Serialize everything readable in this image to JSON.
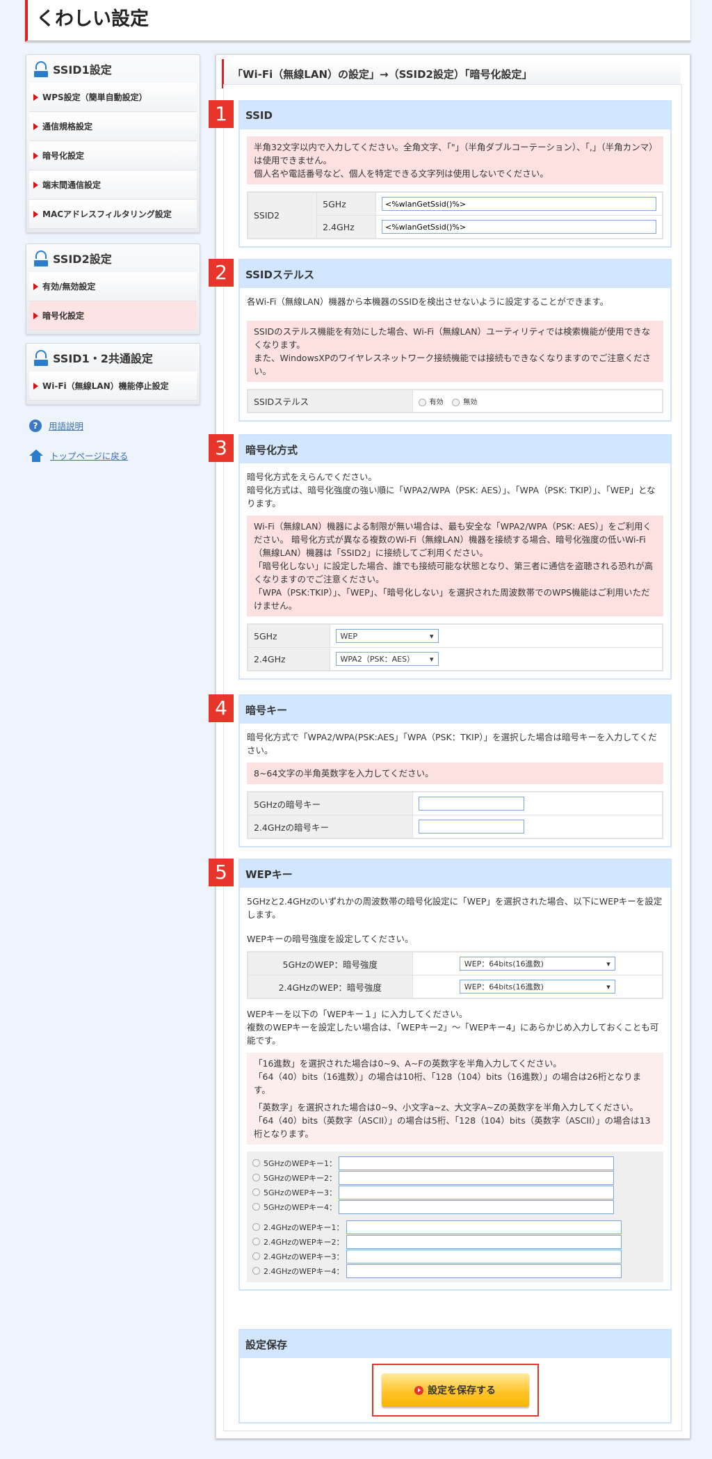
{
  "header": {
    "title": "くわしい設定"
  },
  "sidebar": {
    "groups": [
      {
        "title": "SSID1設定",
        "items": [
          "WPS設定（簡単自動設定）",
          "通信規格設定",
          "暗号化設定",
          "端末間通信設定",
          "MACアドレスフィルタリング設定"
        ]
      },
      {
        "title": "SSID2設定",
        "items": [
          "有効/無効設定",
          "暗号化設定"
        ]
      },
      {
        "title": "SSID1・2共通設定",
        "items": [
          "Wi-Fi（無線LAN）機能停止設定"
        ]
      }
    ],
    "links": {
      "glossary": "用語説明",
      "top": "トップページに戻る"
    }
  },
  "main": {
    "title": "「Wi-Fi（無線LAN）の設定」→（SSID2設定）「暗号化設定」",
    "s1": {
      "num": "1",
      "title": "SSID",
      "warn": "半角32文字以内で入力してください。全角文字、「\"」（半角ダブルコーテーション）、「,」（半角カンマ）は使用できません。",
      "warn2": "個人名や電話番号など、個人を特定できる文字列は使用しないでください。",
      "row_label": "SSID2",
      "b5": "5GHz",
      "b24": "2.4GHz",
      "v5": "<%wlanGetSsid()%>",
      "v24": "<%wlanGetSsid()%>"
    },
    "s2": {
      "num": "2",
      "title": "SSIDステルス",
      "desc": "各Wi-Fi（無線LAN）機器から本機器のSSIDを検出させないように設定することができます。",
      "warn": "SSIDのステルス機能を有効にした場合、Wi-Fi（無線LAN）ユーティリティでは検索機能が使用できなくなります。",
      "warn2": "また、WindowsXPのワイヤレスネットワーク接続機能では接続もできなくなりますのでご注意ください。",
      "label": "SSIDステルス",
      "on": "有効",
      "off": "無効"
    },
    "s3": {
      "num": "3",
      "title": "暗号化方式",
      "desc1": "暗号化方式をえらんでください。",
      "desc2": "暗号化方式は、暗号化強度の強い順に「WPA2/WPA（PSK: AES）」、「WPA（PSK: TKIP）」、「WEP」となります。",
      "warn1": "Wi-Fi（無線LAN）機器による制限が無い場合は、最も安全な「WPA2/WPA（PSK: AES）」をご利用ください。 暗号化方式が異なる複数のWi-Fi（無線LAN）機器を接続する場合、暗号化強度の低いWi-Fi（無線LAN）機器は「SSID2」に接続してご利用ください。",
      "warn2": "「暗号化しない」に設定した場合、誰でも接続可能な状態となり、第三者に通信を盗聴される恐れが高くなりますのでご注意ください。",
      "warn3": "「WPA（PSK:TKIP）」、「WEP」、「暗号化しない」を選択された周波数帯でのWPS機能はご利用いただけません。",
      "b5": "5GHz",
      "b24": "2.4GHz",
      "v5": "WEP",
      "v24": "WPA2（PSK：AES）"
    },
    "s4": {
      "num": "4",
      "title": "暗号キー",
      "desc": "暗号化方式で「WPA2/WPA(PSK:AES」「WPA（PSK：TKIP）」を選択した場合は暗号キーを入力してください。",
      "warn": "8~64文字の半角英数字を入力してください。",
      "l5": "5GHzの暗号キー",
      "l24": "2.4GHzの暗号キー"
    },
    "s5": {
      "num": "5",
      "title": "WEPキー",
      "desc": "5GHzと2.4GHzのいずれかの周波数帯の暗号化設定に「WEP」を選択された場合、以下にWEPキーを設定します。",
      "desc2": "WEPキーの暗号強度を設定してください。",
      "l5": "5GHzのWEP：暗号強度",
      "l24": "2.4GHzのWEP：暗号強度",
      "v5": "WEP：64bits(16進数)",
      "v24": "WEP：64bits(16進数)",
      "desc3": "WEPキーを以下の「WEPキー１」に入力してください。",
      "desc4": "複数のWEPキーを設定したい場合は、「WEPキー2」～「WEPキー4」にあらかじめ入力しておくことも可能です。",
      "w1": "「16進数」を選択された場合は0~9、A~Fの英数字を半角入力してください。",
      "w2": "「64（40）bits（16進数）」の場合は10桁、「128（104）bits（16進数）」の場合は26桁となります。",
      "w3": "「英数字」を選択された場合は0~9、小文字a~z、大文字A~Zの英数字を半角入力してください。",
      "w4": "「64（40）bits（英数字（ASCII）」の場合は5桁、「128（104）bits（英数字（ASCII）」の場合は13桁となります。",
      "keys5": [
        "5GHzのWEPキー1：",
        "5GHzのWEPキー2：",
        "5GHzのWEPキー3：",
        "5GHzのWEPキー4："
      ],
      "keys24": [
        "2.4GHzのWEPキー1：",
        "2.4GHzのWEPキー2：",
        "2.4GHzのWEPキー3：",
        "2.4GHzのWEPキー4："
      ]
    },
    "save": {
      "title": "設定保存",
      "button": "設定を保存する"
    }
  }
}
